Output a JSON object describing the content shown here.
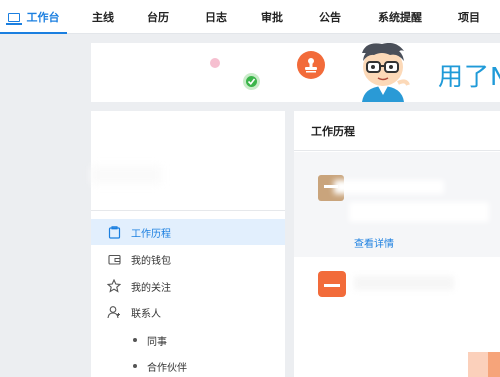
{
  "topnav": {
    "items": [
      {
        "label": "工作台",
        "active": true
      },
      {
        "label": "主线"
      },
      {
        "label": "台历"
      },
      {
        "label": "日志"
      },
      {
        "label": "审批"
      },
      {
        "label": "公告"
      },
      {
        "label": "系统提醒"
      },
      {
        "label": "项目"
      }
    ]
  },
  "banner": {
    "text": "用了N",
    "icons": [
      "pink-dot",
      "check-circle-icon",
      "stamp-icon",
      "mascot-avatar"
    ]
  },
  "sidebar": {
    "items": [
      {
        "label": "工作历程",
        "icon": "portfolio-icon",
        "active": true
      },
      {
        "label": "我的钱包",
        "icon": "wallet-icon"
      },
      {
        "label": "我的关注",
        "icon": "star-icon"
      },
      {
        "label": "联系人",
        "icon": "contacts-icon"
      }
    ],
    "subitems": [
      {
        "label": "同事"
      },
      {
        "label": "合作伙伴"
      }
    ]
  },
  "main": {
    "title": "工作历程",
    "card1_link": "查看详情"
  },
  "colors": {
    "accent": "#1b7fe0",
    "orange": "#f26b3a",
    "tan": "#c9a47c",
    "green": "#3bb54a"
  }
}
